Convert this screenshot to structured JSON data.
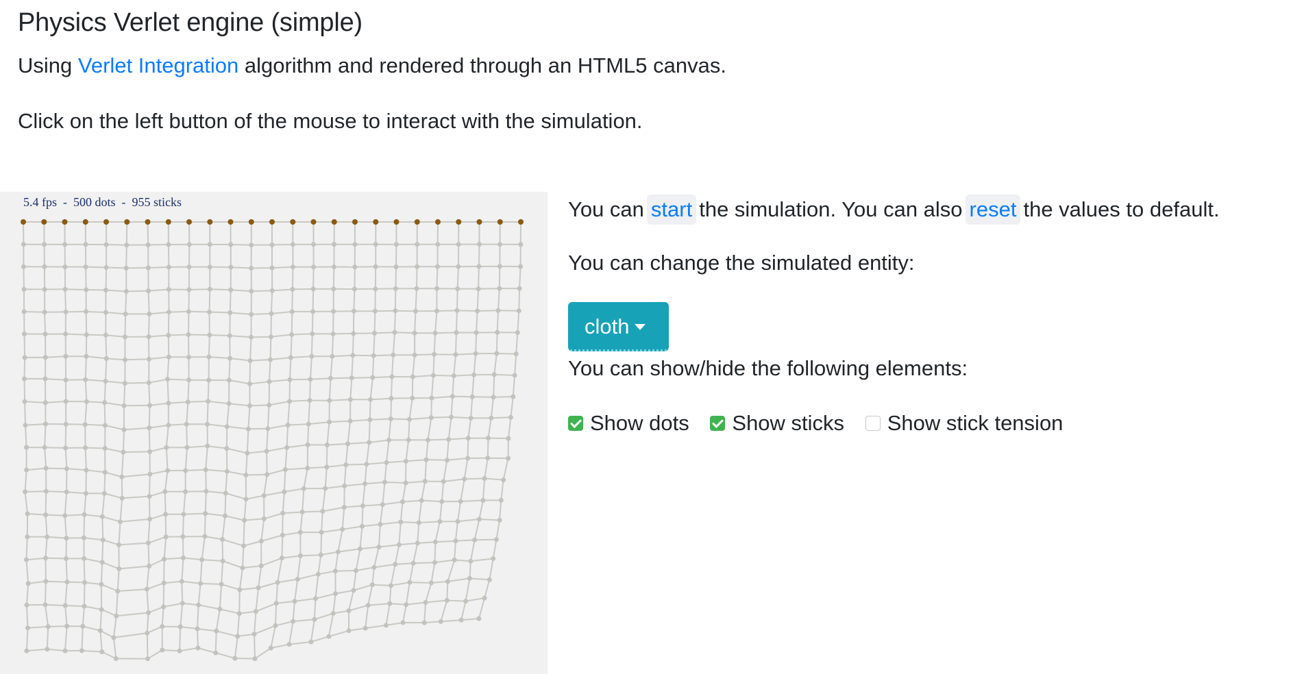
{
  "header": {
    "title": "Physics Verlet engine (simple)",
    "intro_prefix": "Using ",
    "intro_link": "Verlet Integration",
    "intro_suffix": " algorithm and rendered through an HTML5 canvas.",
    "instructions": "Click on the left button of the mouse to interact with the simulation."
  },
  "canvas": {
    "stats": "5.4 fps  -  500 dots  -  955 sticks",
    "pinned_color": "#8b5a14",
    "dot_color": "#c2c2bf",
    "stick_color": "#c8c8c4"
  },
  "controls": {
    "line1_a": "You can",
    "start_label": "start",
    "line1_b": "the simulation. You can also",
    "reset_label": "reset",
    "line1_c": "the values to default.",
    "entity_prompt": "You can change the simulated entity:",
    "entity_value": "cloth",
    "toggle_prompt": "You can show/hide the following elements:",
    "toggles": [
      {
        "label": "Show dots",
        "checked": true
      },
      {
        "label": "Show sticks",
        "checked": true
      },
      {
        "label": "Show stick tension",
        "checked": false
      }
    ]
  },
  "colors": {
    "link": "#0a7cff",
    "dropdown_bg": "#17a2b8",
    "checkbox_on": "#3fb34f"
  }
}
